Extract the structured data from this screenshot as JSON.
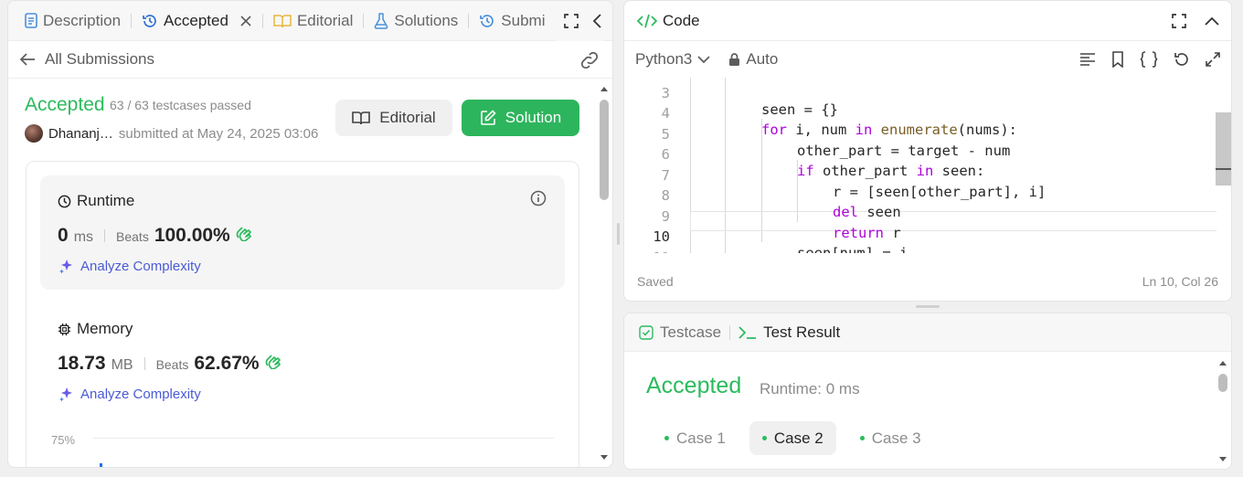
{
  "left_tabs": [
    {
      "label": "Description",
      "icon": "document-icon"
    },
    {
      "label": "Accepted",
      "icon": "history-icon"
    },
    {
      "label": "Editorial",
      "icon": "book-icon"
    },
    {
      "label": "Solutions",
      "icon": "flask-icon"
    },
    {
      "label": "Submi",
      "icon": "history-icon"
    }
  ],
  "subbar": {
    "back_label": "All Submissions"
  },
  "submission": {
    "status": "Accepted",
    "testcases": "63 / 63 testcases passed",
    "user": "Dhananj…",
    "submitted": "submitted at May 24, 2025 03:06",
    "editorial_label": "Editorial",
    "solution_label": "Solution"
  },
  "runtime": {
    "title": "Runtime",
    "value": "0",
    "unit": "ms",
    "beats_label": "Beats",
    "beats": "100.00%",
    "analyze": "Analyze Complexity"
  },
  "memory": {
    "title": "Memory",
    "value": "18.73",
    "unit": "MB",
    "beats_label": "Beats",
    "beats": "62.67%",
    "analyze": "Analyze Complexity"
  },
  "chart": {
    "label": "75%"
  },
  "code_panel": {
    "title": "Code",
    "language": "Python3",
    "mode": "Auto",
    "saved": "Saved",
    "position": "Ln 10, Col 26",
    "current_line": 10
  },
  "code_lines": [
    {
      "n": "3",
      "text": "seen = {}"
    },
    {
      "n": "4",
      "text": "for i, num in enumerate(nums):"
    },
    {
      "n": "5",
      "text": "other_part = target - num"
    },
    {
      "n": "6",
      "text": "if other_part in seen:"
    },
    {
      "n": "7",
      "text": "r = [seen[other_part], i]"
    },
    {
      "n": "8",
      "text": "del seen"
    },
    {
      "n": "9",
      "text": "return r"
    },
    {
      "n": "10",
      "text": "seen[num] = i"
    },
    {
      "n": "11",
      "text": ""
    }
  ],
  "result_panel": {
    "testcase_tab": "Testcase",
    "result_tab": "Test Result",
    "status": "Accepted",
    "runtime": "Runtime: 0 ms",
    "cases": [
      "Case 1",
      "Case 2",
      "Case 3"
    ],
    "active_case": 1
  },
  "colors": {
    "accent_green": "#2cbb5d",
    "button_green": "#2db55d",
    "link_purple": "#4a5bd6"
  }
}
